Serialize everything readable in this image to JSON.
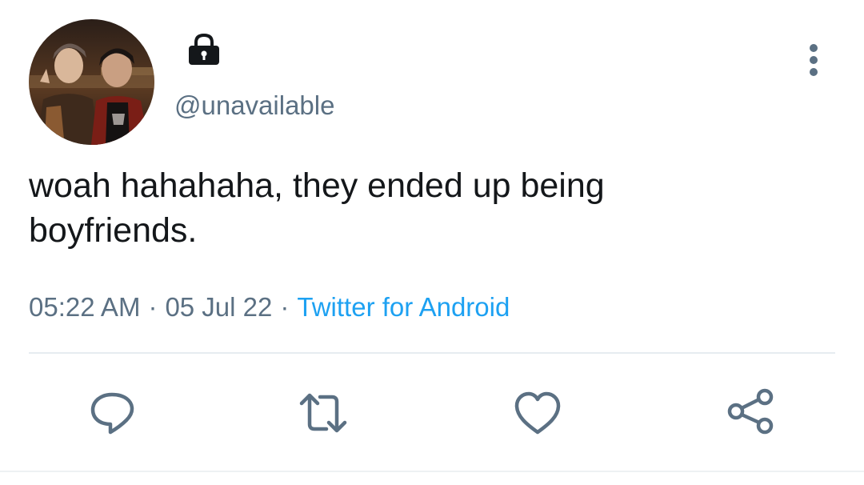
{
  "tweet": {
    "handle": "@unavailable",
    "text_line1": "woah hahahaha, they ended up being",
    "text_line2": "boyfriends.",
    "time": "05:22 AM",
    "separator": "·",
    "date": "05 Jul 22",
    "source": "Twitter for Android"
  },
  "icons": {
    "lock": "lock-icon",
    "more": "more-vertical-icon",
    "reply": "reply-icon",
    "retweet": "retweet-icon",
    "like": "heart-icon",
    "share": "share-icon"
  },
  "colors": {
    "text": "#14171a",
    "muted": "#5b7083",
    "link": "#1da1f2",
    "divider": "#e6ecf0"
  }
}
